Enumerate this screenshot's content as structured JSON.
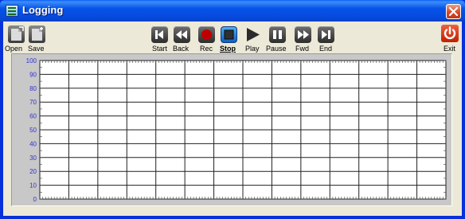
{
  "window": {
    "title": "Logging"
  },
  "colors": {
    "title_bar": "#0753e8",
    "accent_active": "#1f7fd8",
    "rec_red": "#c00000",
    "exit_red": "#e03010",
    "axis_label": "#3333cc"
  },
  "toolbar": {
    "open_label": "Open",
    "save_label": "Save",
    "start_label": "Start",
    "back_label": "Back",
    "rec_label": "Rec",
    "stop_label": "Stop",
    "play_label": "Play",
    "pause_label": "Pause",
    "fwd_label": "Fwd",
    "end_label": "End",
    "exit_label": "Exit",
    "active_button": "Stop"
  },
  "icons": {
    "open": "folder-open-icon",
    "save": "save-icon",
    "start": "skip-start-icon",
    "back": "rewind-icon",
    "rec": "record-icon",
    "stop": "stop-icon",
    "play": "play-icon",
    "pause": "pause-icon",
    "fwd": "fast-forward-icon",
    "end": "skip-end-icon",
    "exit": "power-icon",
    "close": "close-icon"
  },
  "chart": {
    "y_ticks": [
      "100",
      "90",
      "80",
      "70",
      "60",
      "50",
      "40",
      "30",
      "20",
      "10",
      "0"
    ],
    "ylim": [
      0,
      100
    ],
    "x_divisions": 14,
    "grid": true
  }
}
